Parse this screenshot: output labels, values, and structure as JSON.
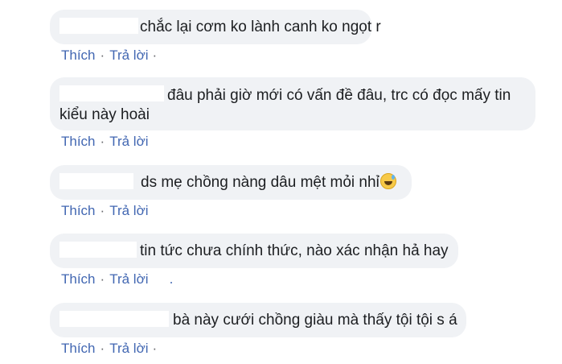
{
  "comments": [
    {
      "text": "chắc lại cơm ko lành canh ko ngọt r",
      "like_label": "Thích",
      "reply_label": "Trả lời"
    },
    {
      "text_line1": "đâu phải giờ mới có vấn đề đâu, trc có đọc mấy tin",
      "text_line2": "kiểu này hoài",
      "like_label": "Thích",
      "reply_label": "Trả lời"
    },
    {
      "text": "ds mẹ chồng nàng dâu mệt mỏi nhỉ",
      "emoji": "grinning-sweat-emoji",
      "like_label": "Thích",
      "reply_label": "Trả lời"
    },
    {
      "text": "tin tức chưa chính thức, nào xác nhận hả hay",
      "like_label": "Thích",
      "reply_label": "Trả lời"
    },
    {
      "text": "bà này cưới chồng giàu mà thấy tội tội s á",
      "like_label": "Thích",
      "reply_label": "Trả lời"
    }
  ],
  "separator": "·",
  "colors": {
    "bubble_bg": "#f0f2f5",
    "link": "#4267b2",
    "text": "#1c1e21"
  }
}
